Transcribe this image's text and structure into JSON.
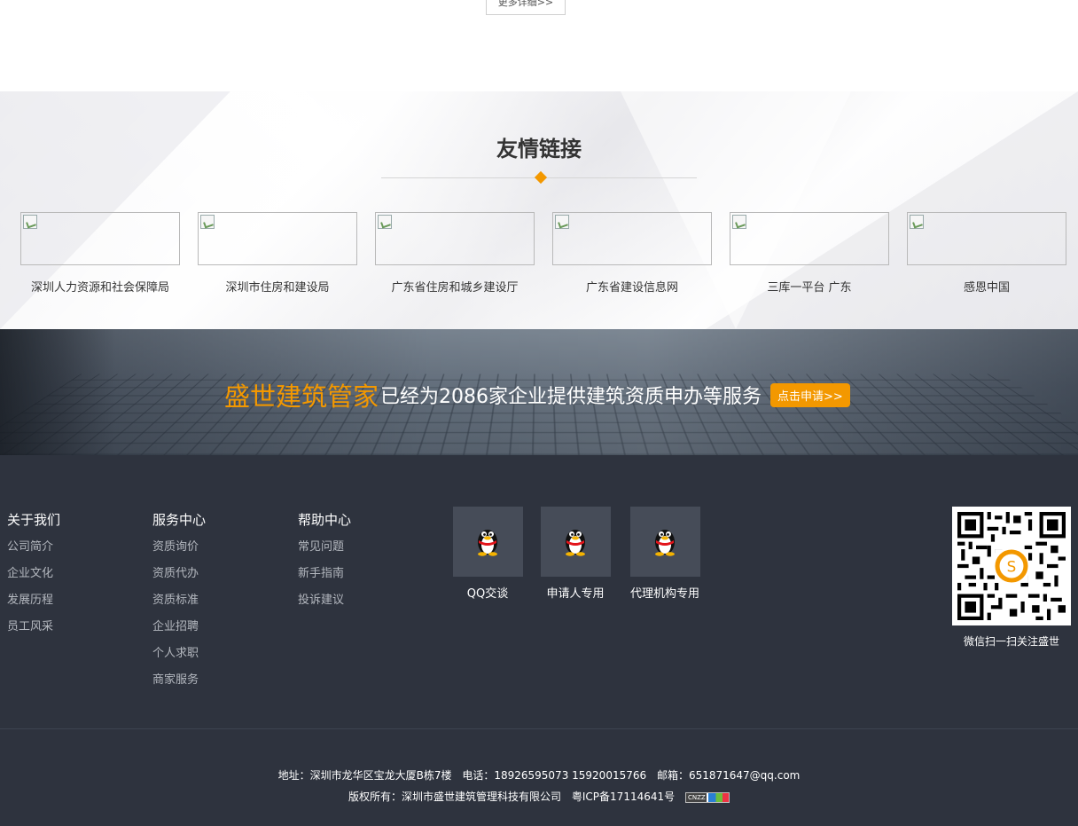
{
  "top": {
    "more_button": "更多详细>>"
  },
  "links": {
    "title": "友情链接",
    "items": [
      {
        "label": "深圳人力资源和社会保障局"
      },
      {
        "label": "深圳市住房和建设局"
      },
      {
        "label": "广东省住房和城乡建设厅"
      },
      {
        "label": "广东省建设信息网"
      },
      {
        "label": "三库一平台 广东"
      },
      {
        "label": "感恩中国"
      }
    ]
  },
  "banner": {
    "brand": "盛世建筑管家",
    "slogan": "已经为2086家企业提供建筑资质申办等服务",
    "apply_button": "点击申请>>"
  },
  "footer": {
    "columns": [
      {
        "title": "关于我们",
        "links": [
          "公司简介",
          "企业文化",
          "发展历程",
          "员工风采"
        ]
      },
      {
        "title": "服务中心",
        "links": [
          "资质询价",
          "资质代办",
          "资质标准",
          "企业招聘",
          "个人求职",
          "商家服务"
        ]
      },
      {
        "title": "帮助中心",
        "links": [
          "常见问题",
          "新手指南",
          "投诉建议"
        ]
      }
    ],
    "qq": [
      {
        "label": "QQ交谈"
      },
      {
        "label": "申请人专用"
      },
      {
        "label": "代理机构专用"
      }
    ],
    "qr_caption": "微信扫一扫关注盛世",
    "address_label": "地址：深圳市龙华区宝龙大厦B栋7楼",
    "phone_label": "电话：18926595073   15920015766",
    "email_label": "邮箱：651871647@qq.com",
    "copyright": "版权所有：深圳市盛世建筑管理科技有限公司",
    "icp": "粤ICP备17114641号",
    "badge": "CNZZ"
  },
  "colors": {
    "accent": "#f39800",
    "footer_bg": "#2e333e"
  }
}
